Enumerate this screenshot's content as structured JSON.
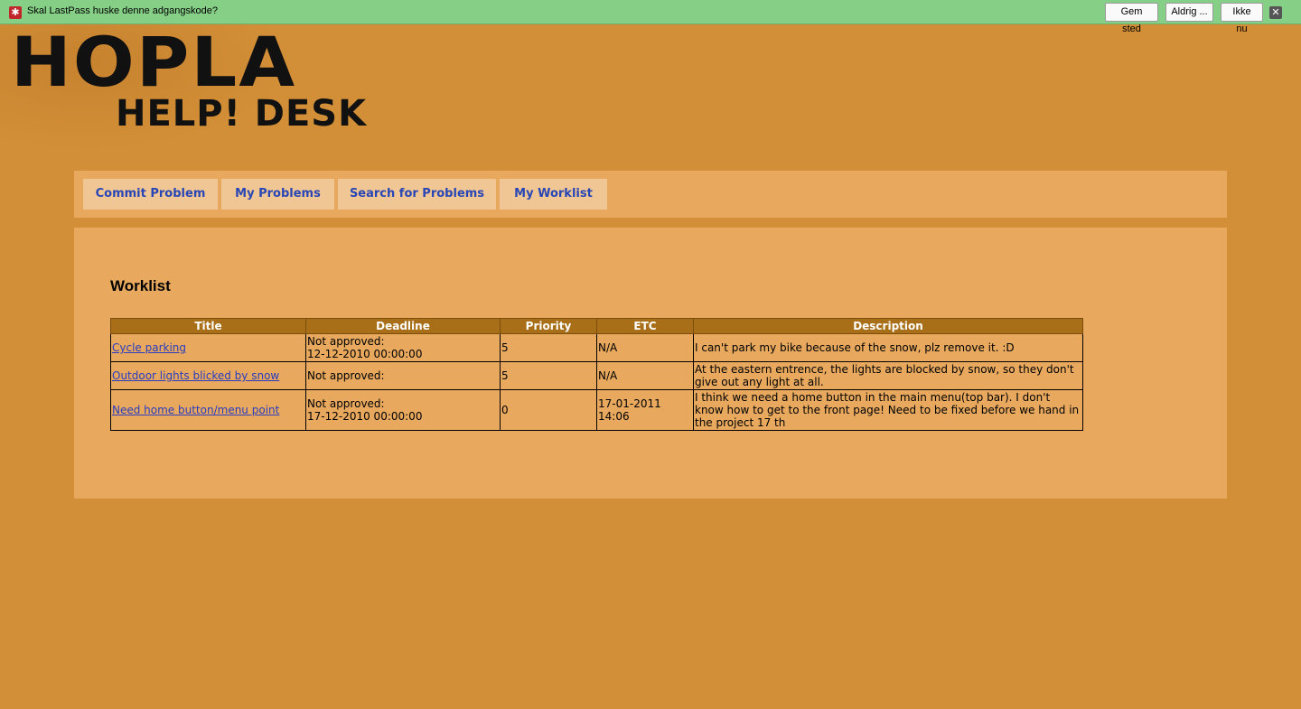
{
  "lastpass": {
    "icon": "asterisk-icon",
    "prompt": "Skal LastPass huske denne adgangskode?",
    "save_label": "Gem sted",
    "never_label": "Aldrig ...",
    "not_now_label": "Ikke nu",
    "close_icon": "close-icon",
    "bar_color": "#86cf86"
  },
  "logo": {
    "main": "HOPLA",
    "sub": "HELP! DESK"
  },
  "menu": {
    "items": [
      {
        "label": "Commit Problem"
      },
      {
        "label": "My Problems"
      },
      {
        "label": "Search for Problems"
      },
      {
        "label": "My Worklist"
      }
    ],
    "link_color": "#2846b5"
  },
  "content": {
    "title": "Worklist",
    "columns": [
      "Title",
      "Deadline",
      "Priority",
      "ETC",
      "Description"
    ],
    "rows": [
      {
        "title": "Cycle parking",
        "deadline_status": "Not approved:",
        "deadline_date": "12-12-2010 00:00:00",
        "priority": "5",
        "etc": "N/A",
        "description": "I can't park my bike because of the snow, plz remove it. :D"
      },
      {
        "title": "Outdoor lights blicked by snow",
        "deadline_status": "Not approved:",
        "deadline_date": "",
        "priority": "5",
        "etc": "N/A",
        "description": "At the eastern entrence, the lights are blocked by snow, so they don't give out any light at all."
      },
      {
        "title": "Need home button/menu point",
        "deadline_status": "Not approved:",
        "deadline_date": "17-12-2010 00:00:00",
        "priority": "0",
        "etc": "17-01-2011 14:06",
        "description": "I think we need a home button in the main menu(top bar). I don't know how to get to the front page! Need to be fixed before we hand in the project 17 th"
      }
    ]
  },
  "colors": {
    "background": "#d38f37",
    "panel": "#e8a95e",
    "header": "#a86f18"
  }
}
